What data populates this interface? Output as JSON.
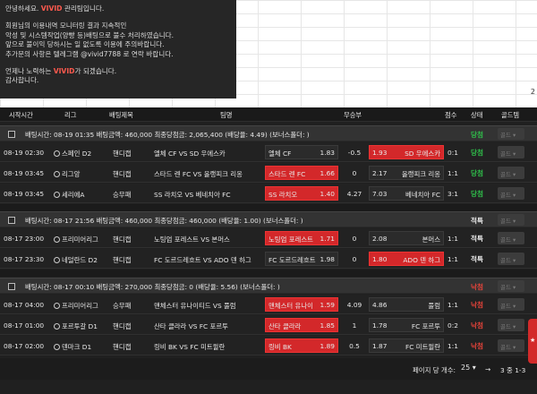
{
  "notice": {
    "line1a": "안녕하세요. ",
    "line1b": "VIVID",
    "line1c": " 관리팀입니다.",
    "line2": "회원님의 이용내역 모니터링 결과 지속적인",
    "line3": "악성 및 시스템작업(양빵 등)배팅으로 불수 처리하였습니다.",
    "line4": "앞으로 불이익 당하시는 일 없도록 이용에 주의바랍니다.",
    "line5": "추가문의 사항은 텔레그램 @vivid7788 로 연락 바랍니다.",
    "line6a": "언제나 노력하는 ",
    "line6b": "VIVID",
    "line6c": "가 되겠습니다.",
    "line7": "감사합니다."
  },
  "sheet_number": "2",
  "headers": {
    "time": "시작시간",
    "league": "리그",
    "bet_type": "배팅제목",
    "teams": "팀명",
    "odds": "무승부",
    "score": "점수",
    "status": "상태",
    "money": "골드템"
  },
  "groups": [
    {
      "info": "배팅시간:  08-19 01:35     배팅금액:  460,000     최종당첨금:  2,065,400   (배당율: 4.49)   (보너스폴더: )",
      "status": "당첨",
      "status_color": "#2fbf4a",
      "drop": "골드 ▾",
      "rows": [
        {
          "time": "08-19 02:30",
          "league": "스페인 D2",
          "type": "핸디캡",
          "match": "엘체 CF VS SD 우에스카",
          "home": "엘체 CF",
          "home_odds": "1.83",
          "mid": "-0.5",
          "away": "SD 우에스카",
          "away_odds": "1.93",
          "pick": "away",
          "score": "0:1",
          "status": "당첨",
          "status_color": "#2fbf4a",
          "drop": "골드 ▾"
        },
        {
          "time": "08-19 03:45",
          "league": "리그앙",
          "type": "핸디캡",
          "match": "스타드 렌 FC VS 올랭피크 리옹",
          "home": "스타드 렌 FC",
          "home_odds": "1.66",
          "mid": "0",
          "away": "올랭피크 리옹",
          "away_odds": "2.17",
          "pick": "home",
          "score": "1:1",
          "status": "당첨",
          "status_color": "#2fbf4a",
          "drop": "골드 ▾"
        },
        {
          "time": "08-19 03:45",
          "league": "세리에A",
          "type": "승무패",
          "match": "SS 라치오 VS 베네치아 FC",
          "home": "SS 라치오",
          "home_odds": "1.40",
          "mid": "4.27",
          "away": "베네치아 FC",
          "away_odds": "7.03",
          "pick": "home",
          "score": "3:1",
          "status": "당첨",
          "status_color": "#2fbf4a",
          "drop": "골드 ▾"
        }
      ]
    },
    {
      "info": "배팅시간:  08-17 21:56     배팅금액:  460,000     최종당첨금:  460,000   (배당율: 1.00)   (보너스폴더: )",
      "status": "적특",
      "status_color": "#e8e8e8",
      "drop": "골드 ▾",
      "rows": [
        {
          "time": "08-17 23:00",
          "league": "프리미어리그",
          "type": "핸디캡",
          "match": "노팅엄 포레스트 VS 본머스",
          "home": "노팅엄 포레스트",
          "home_odds": "1.71",
          "mid": "0",
          "away": "본머스",
          "away_odds": "2.08",
          "pick": "home",
          "score": "1:1",
          "status": "적특",
          "status_color": "#e8e8e8",
          "drop": "골드 ▾"
        },
        {
          "time": "08-17 23:30",
          "league": "네덜란드 D2",
          "type": "핸디캡",
          "match": "FC 도르드레흐트 VS ADO 덴 하그",
          "home": "FC 도르드레흐트",
          "home_odds": "1.98",
          "mid": "0",
          "away": "ADO 덴 하그",
          "away_odds": "1.80",
          "pick": "away",
          "score": "1:1",
          "status": "적특",
          "status_color": "#e8e8e8",
          "drop": "골드 ▾"
        }
      ]
    },
    {
      "info": "배팅시간:  08-17 00:10     배팅금액:  270,000     최종당첨금:  0   (배당율: 5.56)   (보너스폴더: )",
      "status": "낙첨",
      "status_color": "#e5433a",
      "drop": "골드 ▾",
      "rows": [
        {
          "time": "08-17 04:00",
          "league": "프리미어리그",
          "type": "승무패",
          "match": "맨체스터 유나이티드 VS 풀럼",
          "home": "맨체스터 유나이",
          "home_odds": "1.59",
          "mid": "4.09",
          "away": "풀럼",
          "away_odds": "4.86",
          "pick": "home",
          "score": "1:1",
          "status": "낙첨",
          "status_color": "#e5433a",
          "drop": "골드 ▾"
        },
        {
          "time": "08-17 01:00",
          "league": "포르투갈 D1",
          "type": "핸디캡",
          "match": "산타 클라라 VS FC 포르투",
          "home": "산타 클라라",
          "home_odds": "1.85",
          "mid": "1",
          "away": "FC 포르투",
          "away_odds": "1.78",
          "pick": "home",
          "score": "0:2",
          "status": "낙첨",
          "status_color": "#e5433a",
          "drop": "골드 ▾"
        },
        {
          "time": "08-17 02:00",
          "league": "덴마크 D1",
          "type": "핸디캡",
          "match": "링비 BK VS FC 미트윌란",
          "home": "링비 BK",
          "home_odds": "1.89",
          "mid": "0.5",
          "away": "FC 미트윌란",
          "away_odds": "1.87",
          "pick": "home",
          "score": "1:1",
          "status": "낙첨",
          "status_color": "#e5433a",
          "drop": "골드 ▾"
        }
      ]
    }
  ],
  "pager": {
    "label": "페이지 당 개수:",
    "size": "25 ▾",
    "counter": "3 중 1-3",
    "arrow": "→"
  },
  "side_tab_label": "★"
}
